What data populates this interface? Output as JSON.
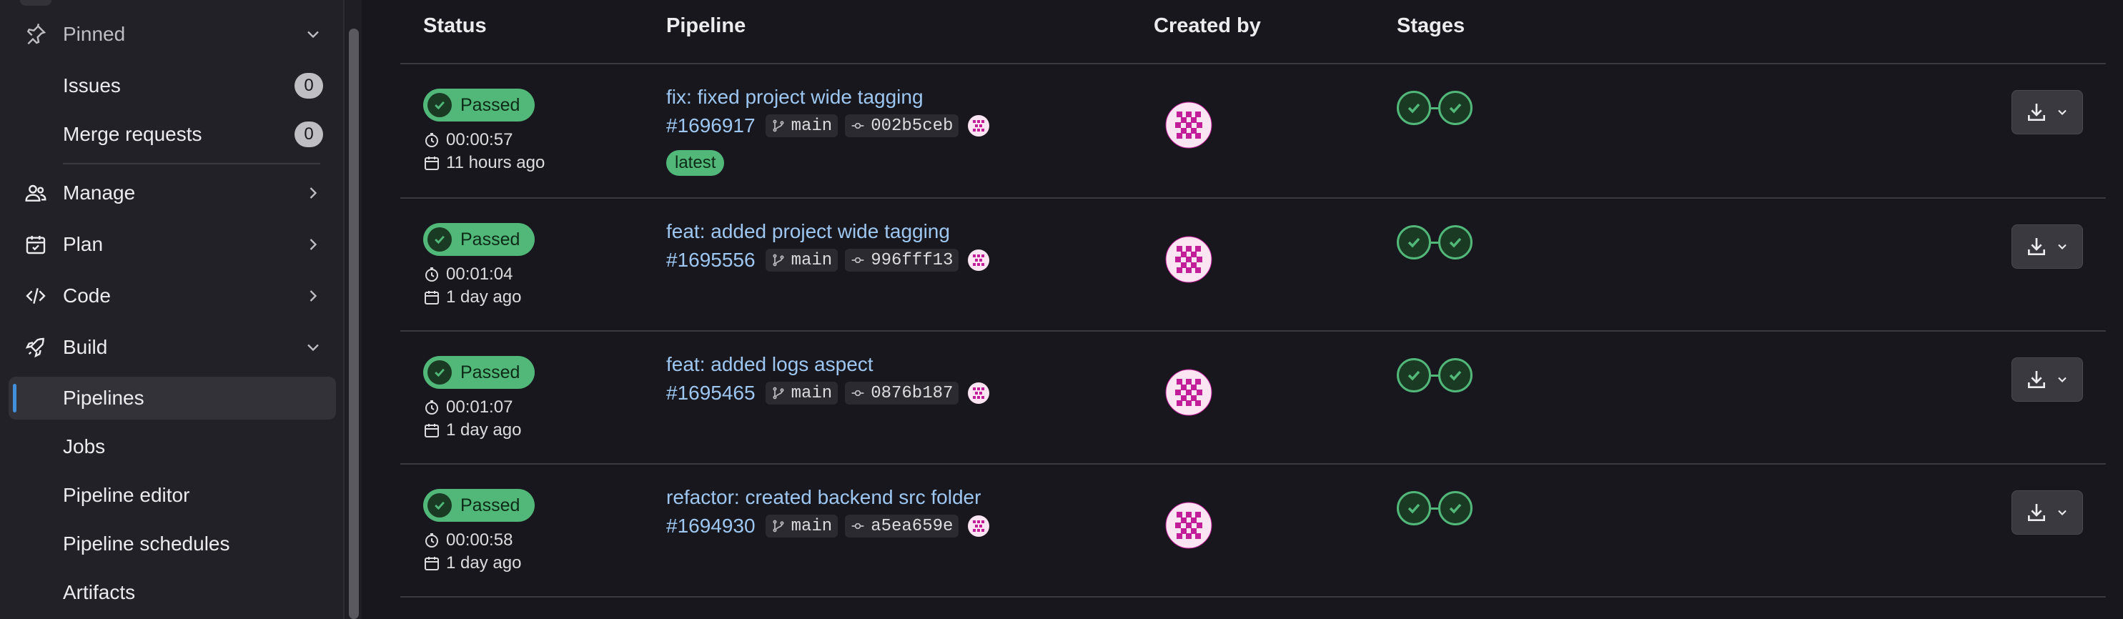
{
  "sidebar": {
    "pinned": "Pinned",
    "issues": {
      "label": "Issues",
      "count": "0"
    },
    "merge_requests": {
      "label": "Merge requests",
      "count": "0"
    },
    "manage": "Manage",
    "plan": "Plan",
    "code": "Code",
    "build": "Build",
    "build_items": [
      "Pipelines",
      "Jobs",
      "Pipeline editor",
      "Pipeline schedules",
      "Artifacts"
    ],
    "active_item": "Pipelines"
  },
  "table": {
    "headers": {
      "status": "Status",
      "pipeline": "Pipeline",
      "created_by": "Created by",
      "stages": "Stages"
    },
    "rows": [
      {
        "status": "Passed",
        "duration": "00:00:57",
        "finished": "11 hours ago",
        "title": "fix: fixed project wide tagging",
        "id": "#1696917",
        "branch": "main",
        "commit": "002b5ceb",
        "badge": "latest",
        "stages": [
          "passed",
          "passed"
        ]
      },
      {
        "status": "Passed",
        "duration": "00:01:04",
        "finished": "1 day ago",
        "title": "feat: added project wide tagging",
        "id": "#1695556",
        "branch": "main",
        "commit": "996fff13",
        "badge": "",
        "stages": [
          "passed",
          "passed"
        ]
      },
      {
        "status": "Passed",
        "duration": "00:01:07",
        "finished": "1 day ago",
        "title": "feat: added logs aspect",
        "id": "#1695465",
        "branch": "main",
        "commit": "0876b187",
        "badge": "",
        "stages": [
          "passed",
          "passed"
        ]
      },
      {
        "status": "Passed",
        "duration": "00:00:58",
        "finished": "1 day ago",
        "title": "refactor: created backend src folder",
        "id": "#1694930",
        "branch": "main",
        "commit": "a5ea659e",
        "badge": "",
        "stages": [
          "passed",
          "passed"
        ]
      }
    ]
  },
  "icons": {
    "pin": "pin-icon",
    "manage": "users-icon",
    "plan": "calendar-icon",
    "code": "code-icon",
    "build": "rocket-icon",
    "clock": "clock-icon",
    "calendar": "calendar-icon",
    "branch": "branch-icon",
    "commit": "commit-icon",
    "download": "download-icon",
    "chevron": "chevron-down-icon",
    "check": "check-icon"
  },
  "colors": {
    "success": "#52b87a",
    "link": "#9dc7f1",
    "active_indicator": "#428fdc",
    "avatar": "#c21e9a"
  }
}
